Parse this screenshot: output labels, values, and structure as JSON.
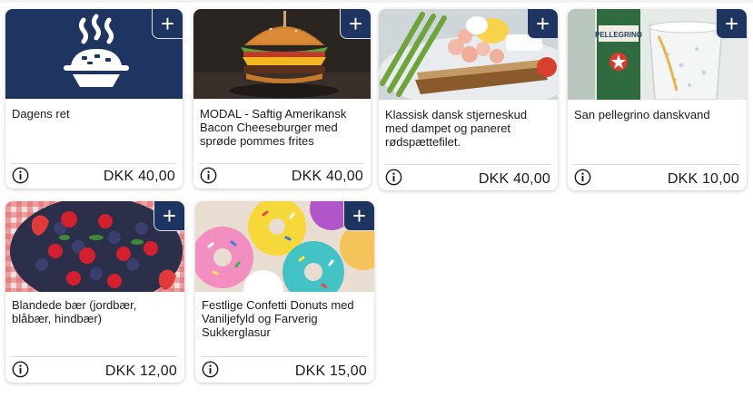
{
  "products": [
    {
      "id": "c1",
      "title": "Dagens ret",
      "price": "DKK 40,00",
      "image_icon": "steaming-dish-icon",
      "add_label": "+"
    },
    {
      "id": "c2",
      "title": "MODAL - Saftig Amerikansk Bacon Cheeseburger med sprøde pommes frites",
      "price": "DKK 40,00",
      "image_icon": "burger-photo",
      "add_label": "+"
    },
    {
      "id": "c3",
      "title": "Klassisk dansk stjerneskud med dampet og paneret rødspættefilet.",
      "price": "DKK 40,00",
      "image_icon": "open-sandwich-photo",
      "add_label": "+"
    },
    {
      "id": "c4",
      "title": "San pellegrino danskvand",
      "price": "DKK 10,00",
      "image_icon": "sparkling-water-photo",
      "add_label": "+"
    },
    {
      "id": "c5",
      "title": "Blandede bær (jordbær, blåbær, hindbær)",
      "price": "DKK 12,00",
      "image_icon": "berries-photo",
      "add_label": "+"
    },
    {
      "id": "c6",
      "title": "Festlige Confetti Donuts med Vaniljefyld og Farverig Sukkerglasur",
      "price": "DKK 15,00",
      "image_icon": "donuts-photo",
      "add_label": "+"
    }
  ],
  "bottle_label": "PELLEGRINO",
  "colors": {
    "accent": "#1d3560",
    "card_bg": "#ffffff",
    "separator": "#d9d9d9"
  }
}
